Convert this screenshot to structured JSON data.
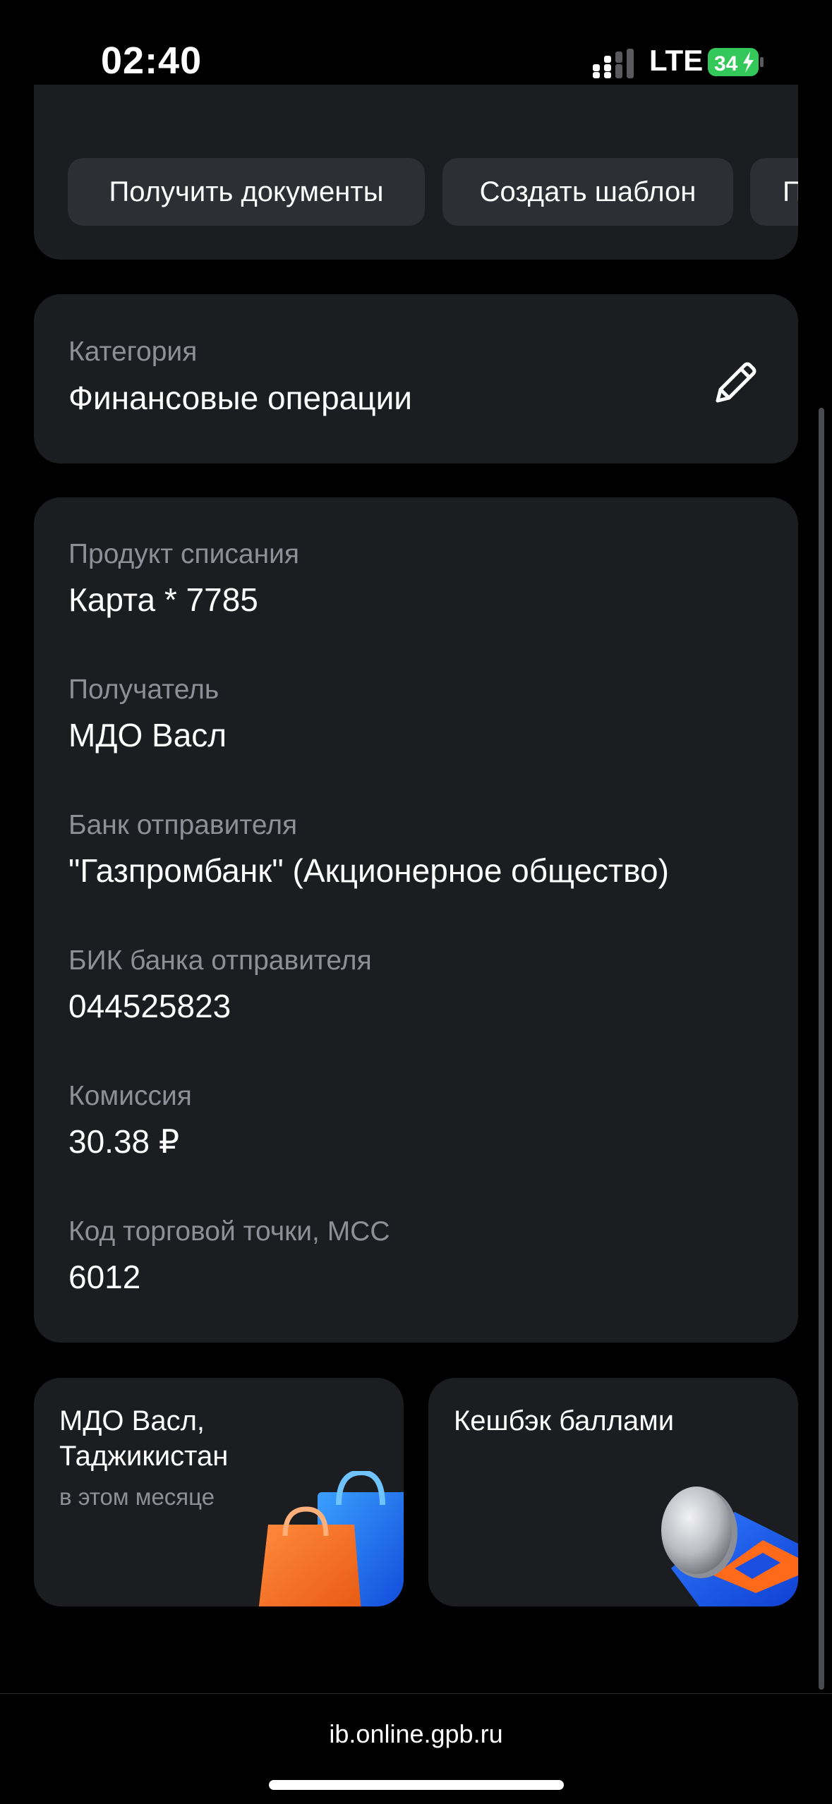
{
  "status_bar": {
    "time": "02:40",
    "network": "LTE",
    "battery_level": "34",
    "battery_color": "#34c759"
  },
  "actions": {
    "items": [
      {
        "label": "Получить документы"
      },
      {
        "label": "Создать шаблон"
      },
      {
        "label": "П"
      }
    ]
  },
  "category": {
    "label": "Категория",
    "value": "Финансовые операции",
    "edit_icon": "pencil-icon"
  },
  "details": [
    {
      "label": "Продукт списания",
      "value": "Карта * 7785"
    },
    {
      "label": "Получатель",
      "value": "МДО Васл"
    },
    {
      "label": "Банк отправителя",
      "value": "\"Газпромбанк\" (Акционерное общество)"
    },
    {
      "label": "БИК банка отправителя",
      "value": "044525823"
    },
    {
      "label": "Комиссия",
      "value": "30.38 ₽"
    },
    {
      "label": "Код торговой точки, MCC",
      "value": "6012"
    }
  ],
  "promos": [
    {
      "title_line1": "МДО Васл,",
      "title_line2": "Таджикистан",
      "subtitle": "в этом месяце",
      "art": "shopping-bags-icon"
    },
    {
      "title_line1": "Кешбэк баллами",
      "art": "coin-icon"
    }
  ],
  "browser": {
    "url": "ib.online.gpb.ru"
  }
}
